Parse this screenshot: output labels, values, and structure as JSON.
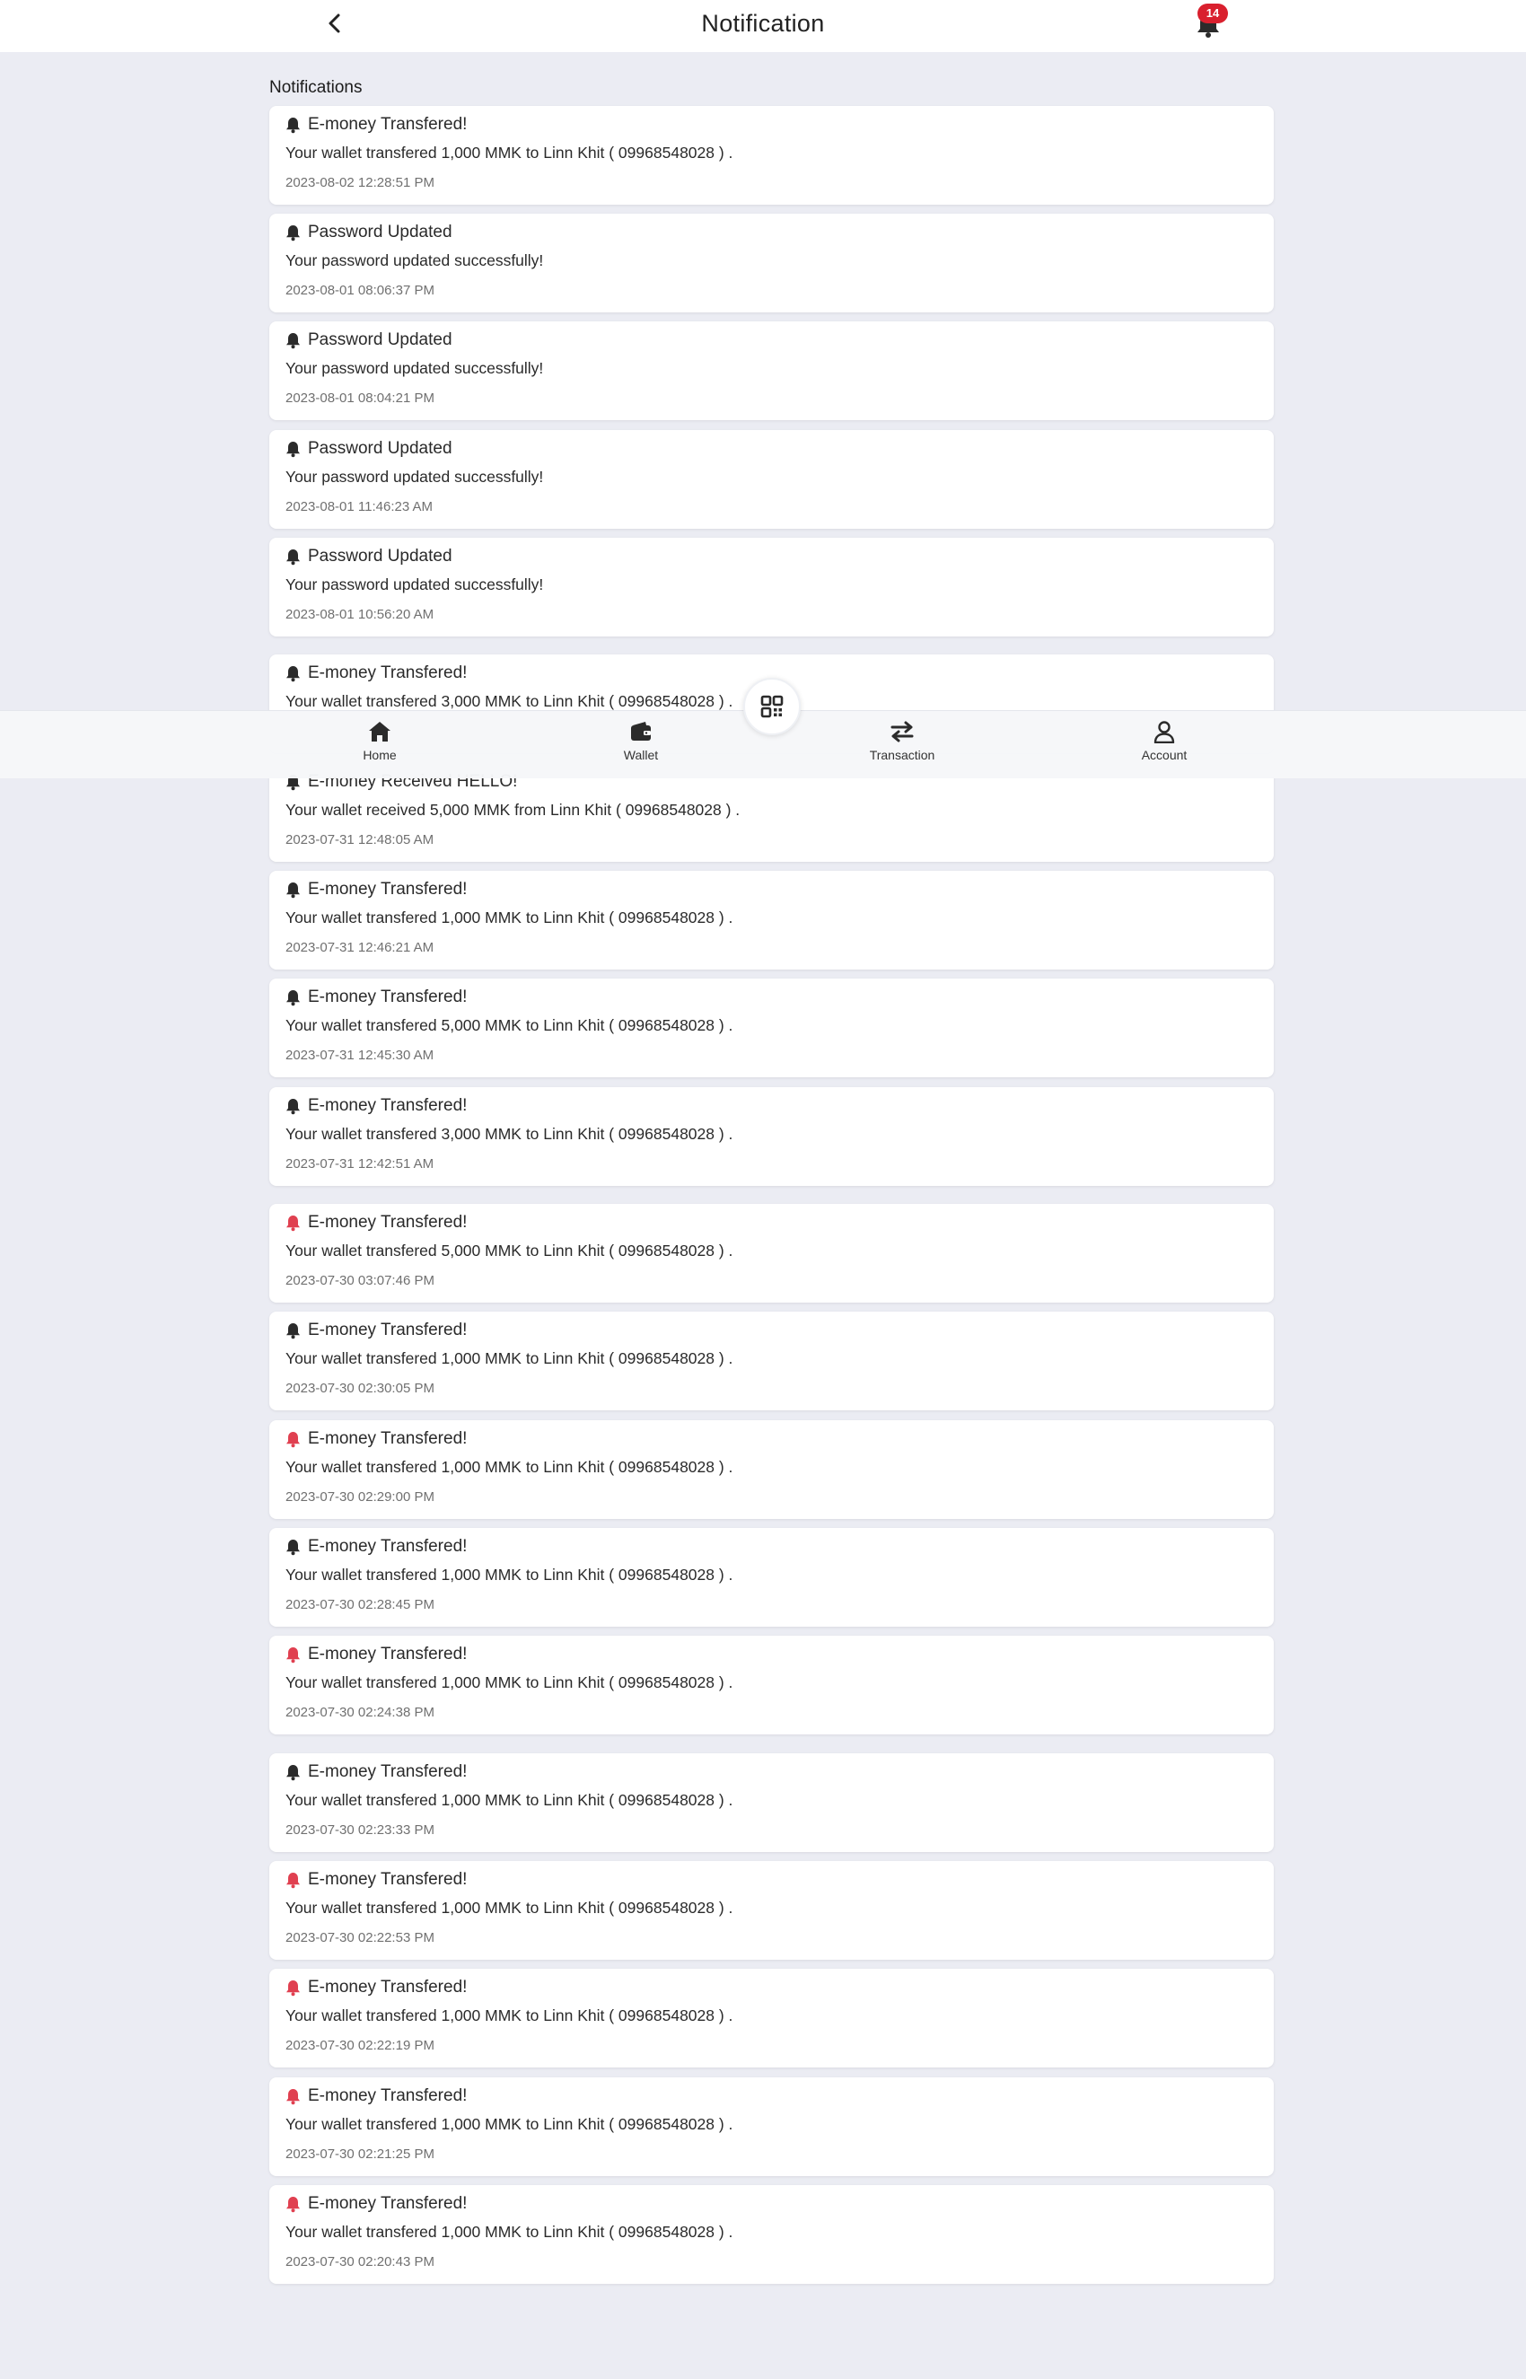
{
  "header": {
    "title": "Notification",
    "badge_count": "14"
  },
  "section_title": "Notifications",
  "notifications": [
    {
      "title": "E-money Transfered!",
      "message": "Your wallet transfered 1,000 MMK to Linn Khit ( 09968548028 ) .",
      "time": "2023-08-02 12:28:51 PM",
      "bell_color": "#2b2b2b"
    },
    {
      "title": "Password Updated",
      "message": "Your password updated successfully!",
      "time": "2023-08-01 08:06:37 PM",
      "bell_color": "#2b2b2b"
    },
    {
      "title": "Password Updated",
      "message": "Your password updated successfully!",
      "time": "2023-08-01 08:04:21 PM",
      "bell_color": "#2b2b2b"
    },
    {
      "title": "Password Updated",
      "message": "Your password updated successfully!",
      "time": "2023-08-01 11:46:23 AM",
      "bell_color": "#2b2b2b"
    },
    {
      "title": "Password Updated",
      "message": "Your password updated successfully!",
      "time": "2023-08-01 10:56:20 AM",
      "bell_color": "#2b2b2b"
    },
    {
      "title": "E-money Transfered!",
      "message": "Your wallet transfered 3,000 MMK to Linn Khit ( 09968548028 ) .",
      "time": "",
      "bell_color": "#2b2b2b"
    },
    {
      "title": "E-money Received HELLO!",
      "message": "Your wallet received 5,000 MMK from Linn Khit ( 09968548028 ) .",
      "time": "2023-07-31 12:48:05 AM",
      "bell_color": "#2b2b2b"
    },
    {
      "title": "E-money Transfered!",
      "message": "Your wallet transfered 1,000 MMK to Linn Khit ( 09968548028 ) .",
      "time": "2023-07-31 12:46:21 AM",
      "bell_color": "#2b2b2b"
    },
    {
      "title": "E-money Transfered!",
      "message": "Your wallet transfered 5,000 MMK to Linn Khit ( 09968548028 ) .",
      "time": "2023-07-31 12:45:30 AM",
      "bell_color": "#2b2b2b"
    },
    {
      "title": "E-money Transfered!",
      "message": "Your wallet transfered 3,000 MMK to Linn Khit ( 09968548028 ) .",
      "time": "2023-07-31 12:42:51 AM",
      "bell_color": "#2b2b2b"
    },
    {
      "title": "E-money Transfered!",
      "message": "Your wallet transfered 5,000 MMK to Linn Khit ( 09968548028 ) .",
      "time": "2023-07-30 03:07:46 PM",
      "bell_color": "#e04050"
    },
    {
      "title": "E-money Transfered!",
      "message": "Your wallet transfered 1,000 MMK to Linn Khit ( 09968548028 ) .",
      "time": "2023-07-30 02:30:05 PM",
      "bell_color": "#2b2b2b"
    },
    {
      "title": "E-money Transfered!",
      "message": "Your wallet transfered 1,000 MMK to Linn Khit ( 09968548028 ) .",
      "time": "2023-07-30 02:29:00 PM",
      "bell_color": "#e04050"
    },
    {
      "title": "E-money Transfered!",
      "message": "Your wallet transfered 1,000 MMK to Linn Khit ( 09968548028 ) .",
      "time": "2023-07-30 02:28:45 PM",
      "bell_color": "#2b2b2b"
    },
    {
      "title": "E-money Transfered!",
      "message": "Your wallet transfered 1,000 MMK to Linn Khit ( 09968548028 ) .",
      "time": "2023-07-30 02:24:38 PM",
      "bell_color": "#e04050"
    },
    {
      "title": "E-money Transfered!",
      "message": "Your wallet transfered 1,000 MMK to Linn Khit ( 09968548028 ) .",
      "time": "2023-07-30 02:23:33 PM",
      "bell_color": "#2b2b2b"
    },
    {
      "title": "E-money Transfered!",
      "message": "Your wallet transfered 1,000 MMK to Linn Khit ( 09968548028 ) .",
      "time": "2023-07-30 02:22:53 PM",
      "bell_color": "#e04050"
    },
    {
      "title": "E-money Transfered!",
      "message": "Your wallet transfered 1,000 MMK to Linn Khit ( 09968548028 ) .",
      "time": "2023-07-30 02:22:19 PM",
      "bell_color": "#e04050"
    },
    {
      "title": "E-money Transfered!",
      "message": "Your wallet transfered 1,000 MMK to Linn Khit ( 09968548028 ) .",
      "time": "2023-07-30 02:21:25 PM",
      "bell_color": "#e04050"
    },
    {
      "title": "E-money Transfered!",
      "message": "Your wallet transfered 1,000 MMK to Linn Khit ( 09968548028 ) .",
      "time": "2023-07-30 02:20:43 PM",
      "bell_color": "#e04050"
    }
  ],
  "bottom_nav": {
    "items": [
      {
        "label": "Home",
        "icon": "home-icon"
      },
      {
        "label": "Wallet",
        "icon": "wallet-icon"
      },
      {
        "label": "Transaction",
        "icon": "transfer-arrows-icon"
      },
      {
        "label": "Account",
        "icon": "user-icon"
      }
    ],
    "scan_icon": "qr-scan-icon"
  },
  "colors": {
    "background": "#ebecf3",
    "badge": "#d9202e",
    "unread_bell": "#e04050",
    "read_bell": "#2b2b2b"
  }
}
